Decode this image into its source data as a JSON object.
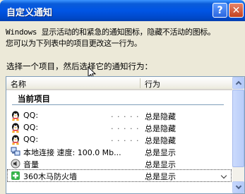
{
  "window": {
    "title": "自定义通知",
    "help_label": "?",
    "close_label": "✕"
  },
  "description": {
    "line1": "Windows 显示活动的和紧急的通知图标，隐藏不活动的图标。",
    "line2": "您可以为下列表中的项目更改这一行为。"
  },
  "instruction": "选择一个项目，然后选择它的通知行为：",
  "list": {
    "columns": {
      "name": "名称",
      "behavior": "行为"
    },
    "group_label": "当前项目",
    "rows": [
      {
        "name": "QQ:",
        "dots": ". . . . .",
        "behavior": "总是隐藏",
        "icon": "qq-penguin-icon"
      },
      {
        "name": "QQ:",
        "dots": ". . . . .",
        "behavior": "总是隐藏",
        "icon": "qq-penguin-icon"
      },
      {
        "name": "QQ:",
        "dots": ". . . . .",
        "behavior": "总是隐藏",
        "icon": "qq-penguin-icon"
      },
      {
        "name": "本地连接 速度: 100.0 Mb...",
        "dots": "",
        "behavior": "总是显示",
        "icon": "network-icon"
      },
      {
        "name": "音量",
        "dots": "",
        "behavior": "总是显示",
        "icon": "volume-icon"
      },
      {
        "name": "360木马防火墙",
        "dots": "",
        "behavior": "总是显示",
        "icon": "firewall-icon"
      }
    ]
  },
  "colors": {
    "title_bar": "#0055e5",
    "window_bg": "#ece9d8",
    "list_border": "#7f9db9"
  }
}
